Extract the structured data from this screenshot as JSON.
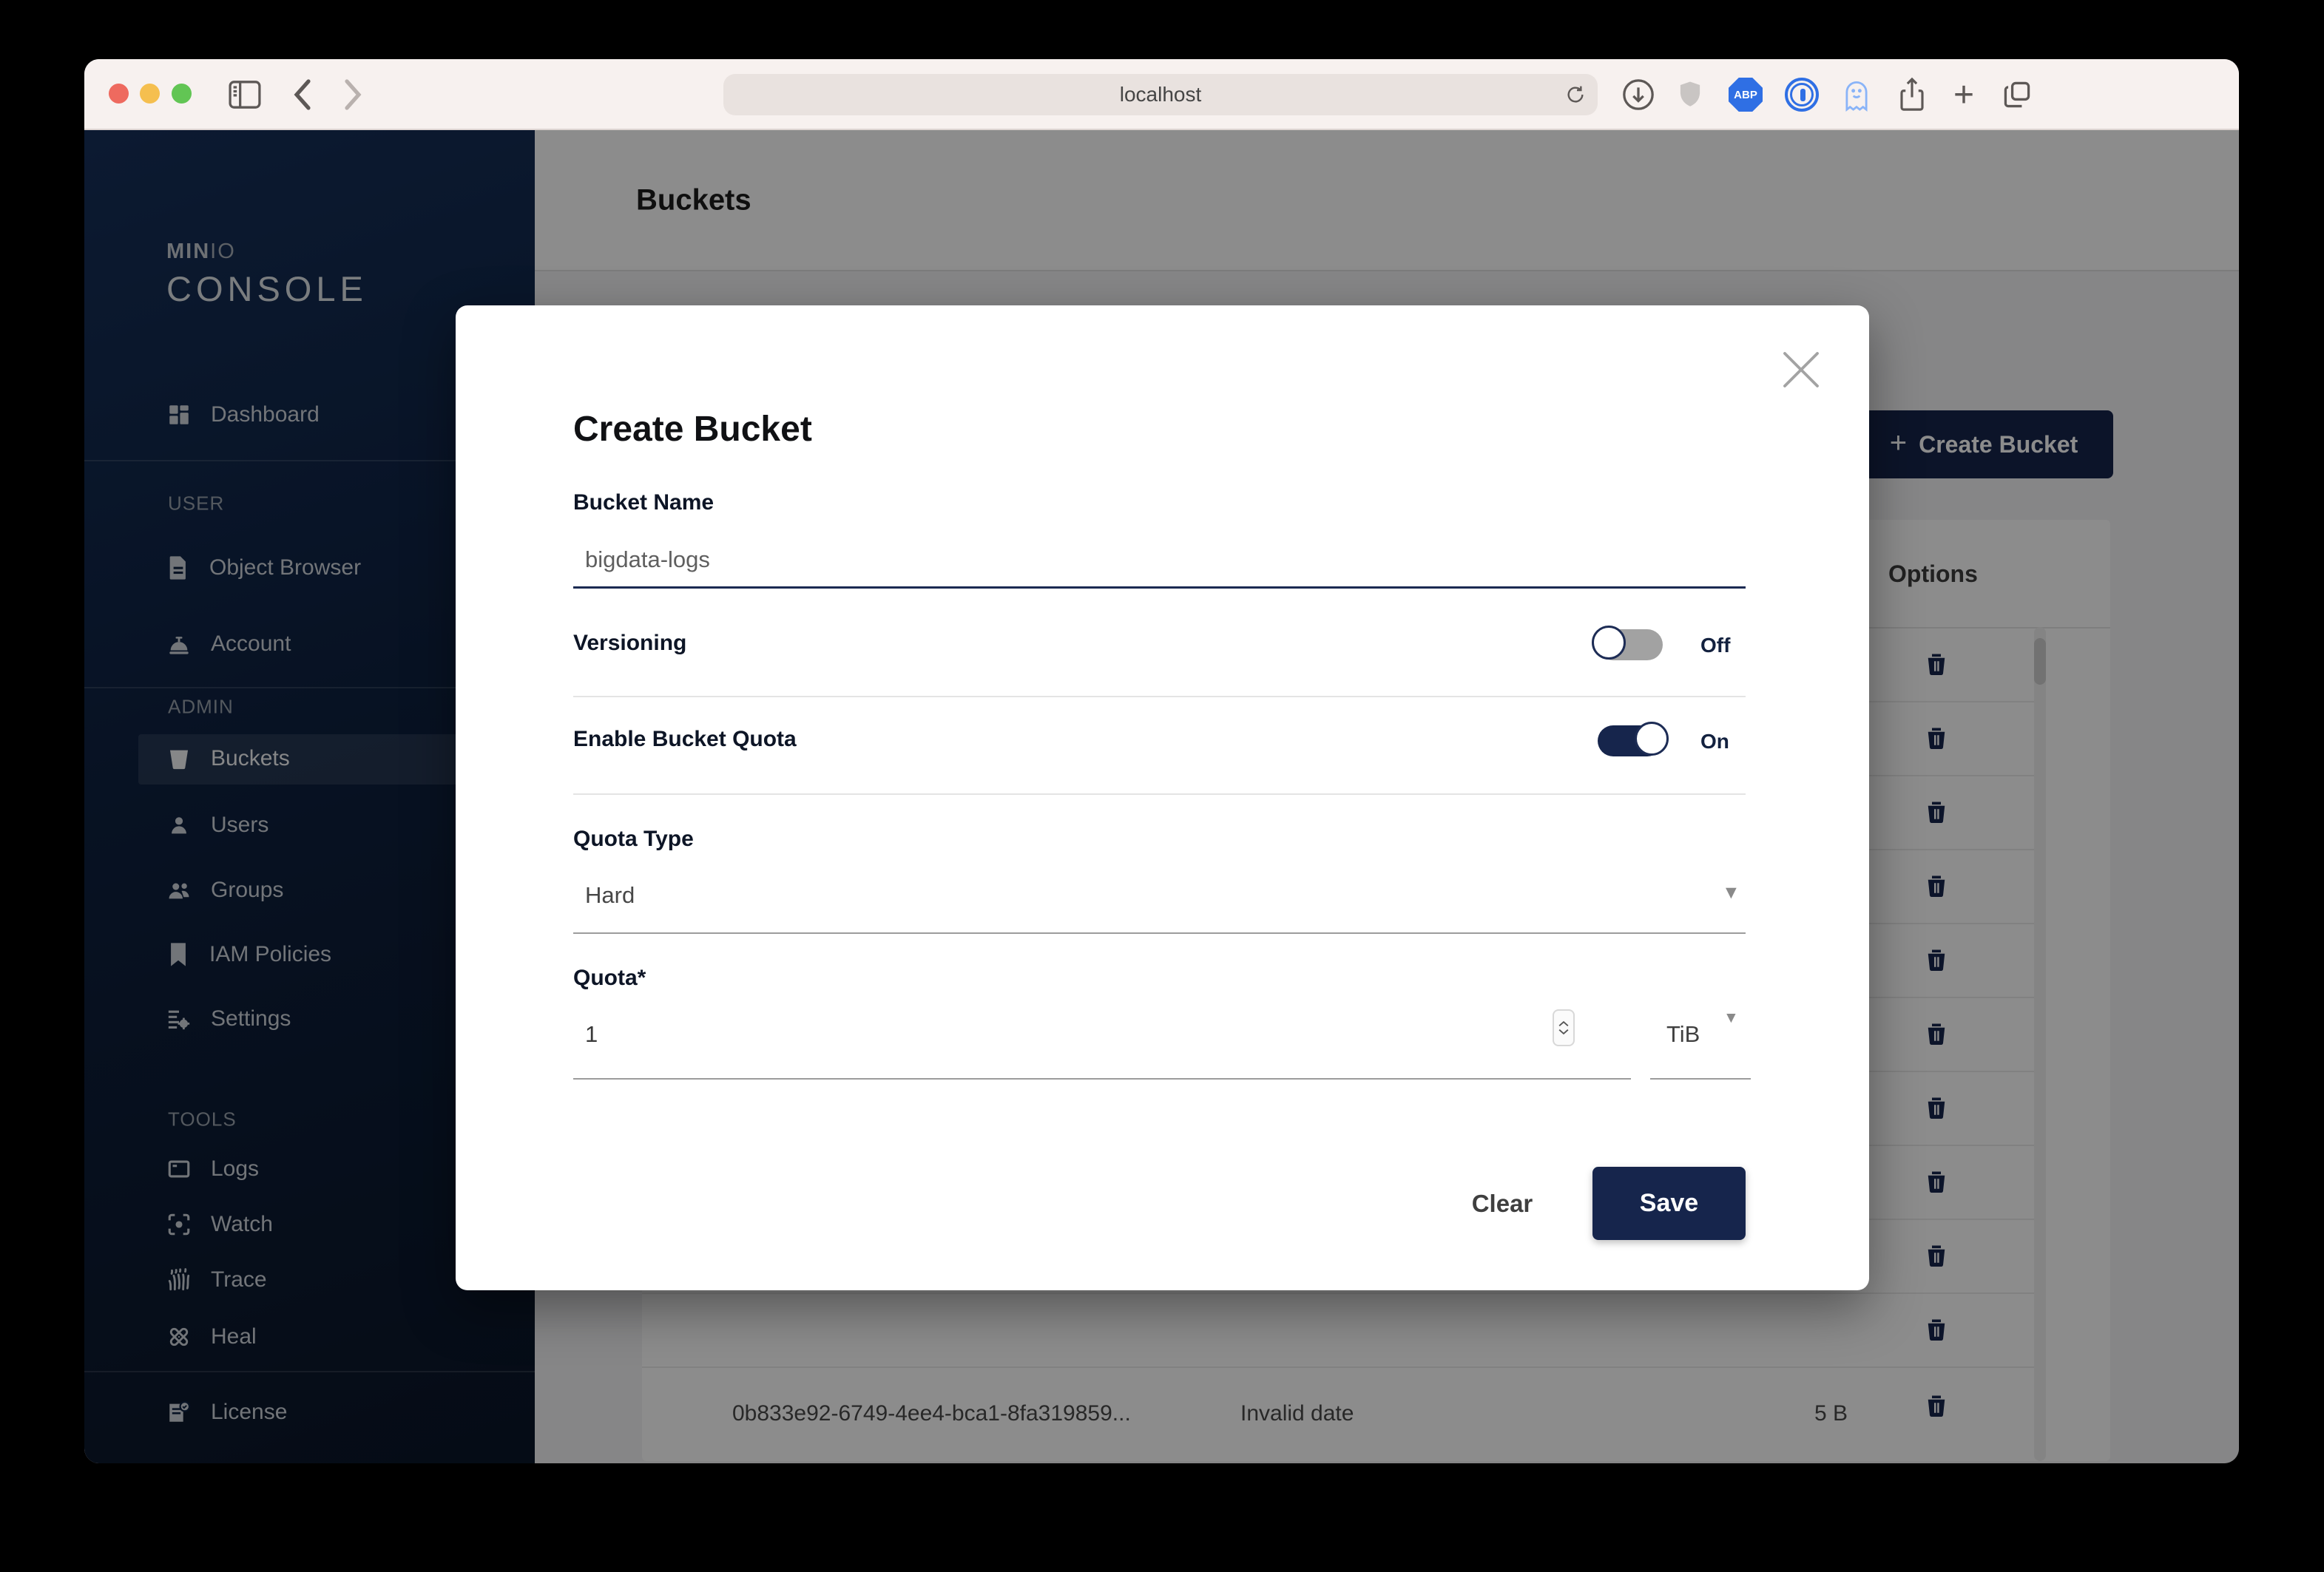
{
  "browser": {
    "url": "localhost",
    "extension_icons": [
      "download-icon",
      "shield-icon",
      "adblock-plus-icon",
      "onepassword-icon",
      "ghostery-icon",
      "share-icon",
      "new-tab-icon",
      "tab-overview-icon"
    ],
    "traffic_light_colors": {
      "close": "#ee6a5f",
      "minimize": "#f5bf4f",
      "zoom": "#62c554"
    }
  },
  "sidebar": {
    "logo": {
      "brand_bold": "MIN",
      "brand_light": "IO",
      "product": "CONSOLE"
    },
    "sections": {
      "user": "USER",
      "admin": "ADMIN",
      "tools": "TOOLS"
    },
    "items": [
      {
        "label": "Dashboard",
        "icon": "dashboard-icon"
      },
      {
        "label": "Object Browser",
        "icon": "object-browser-icon"
      },
      {
        "label": "Account",
        "icon": "account-icon"
      },
      {
        "label": "Buckets",
        "icon": "buckets-icon",
        "active": true
      },
      {
        "label": "Users",
        "icon": "users-icon"
      },
      {
        "label": "Groups",
        "icon": "groups-icon"
      },
      {
        "label": "IAM Policies",
        "icon": "iam-policies-icon"
      },
      {
        "label": "Settings",
        "icon": "settings-icon"
      },
      {
        "label": "Logs",
        "icon": "logs-icon"
      },
      {
        "label": "Watch",
        "icon": "watch-icon"
      },
      {
        "label": "Trace",
        "icon": "trace-icon"
      },
      {
        "label": "Heal",
        "icon": "heal-icon"
      },
      {
        "label": "License",
        "icon": "license-icon"
      }
    ]
  },
  "page": {
    "title": "Buckets",
    "create_button": "Create Bucket"
  },
  "table": {
    "options_header": "Options",
    "trash_row_count": 10,
    "last_row": {
      "name": "0b833e92-6749-4ee4-bca1-8fa319859...",
      "date": "Invalid date",
      "size": "5 B"
    }
  },
  "modal": {
    "title": "Create Bucket",
    "bucket_name": {
      "label": "Bucket Name",
      "value": "bigdata-logs"
    },
    "versioning": {
      "label": "Versioning",
      "state": "Off"
    },
    "quota_enabled": {
      "label": "Enable Bucket Quota",
      "state": "On"
    },
    "quota_type": {
      "label": "Quota Type",
      "value": "Hard"
    },
    "quota": {
      "label": "Quota*",
      "value": "1",
      "unit": "TiB"
    },
    "buttons": {
      "clear": "Clear",
      "save": "Save"
    }
  },
  "glyphs": {
    "caret_down": "▼",
    "plus": "+"
  },
  "colors": {
    "accent_navy": "#16254c",
    "sidebar_top": "#16305a",
    "sidebar_bottom": "#0a1628",
    "chrome_bg": "#f7f1ef",
    "overlay": "rgba(0,0,0,0.45)"
  }
}
